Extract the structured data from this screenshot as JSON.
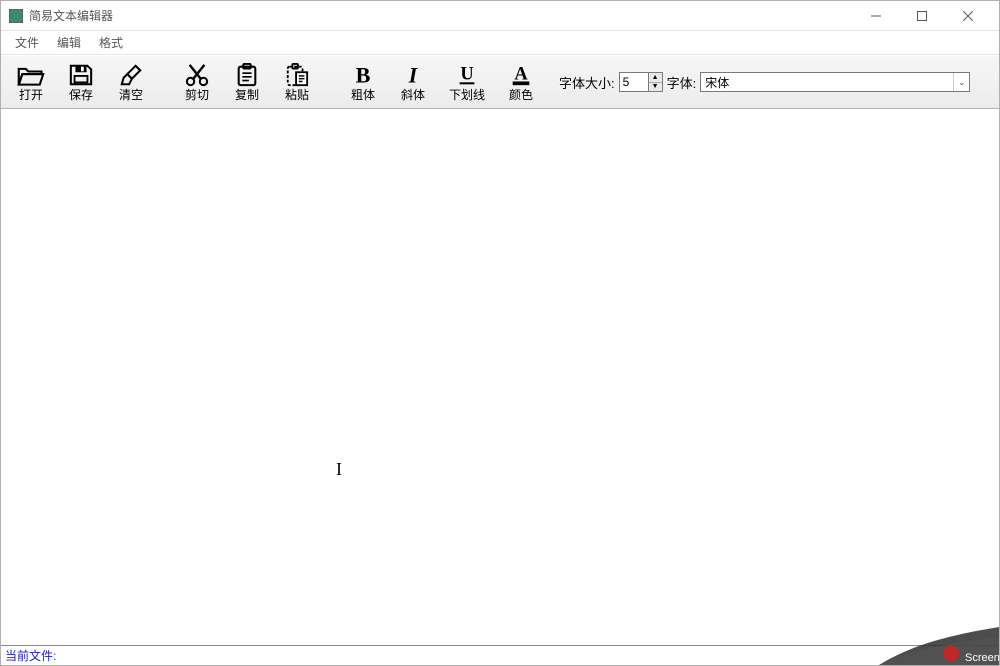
{
  "window": {
    "title": "简易文本编辑器"
  },
  "menu": {
    "file": "文件",
    "edit": "编辑",
    "format": "格式"
  },
  "toolbar": {
    "open": "打开",
    "save": "保存",
    "clear": "清空",
    "cut": "剪切",
    "copy": "复制",
    "paste": "粘贴",
    "bold": "粗体",
    "italic": "斜体",
    "underline": "下划线",
    "color": "颜色",
    "fontsize_label": "字体大小:",
    "fontsize_value": "5",
    "fontname_label": "字体:",
    "fontname_value": "宋体"
  },
  "status": {
    "label": "当前文件:"
  },
  "corner_text": "Screenp"
}
